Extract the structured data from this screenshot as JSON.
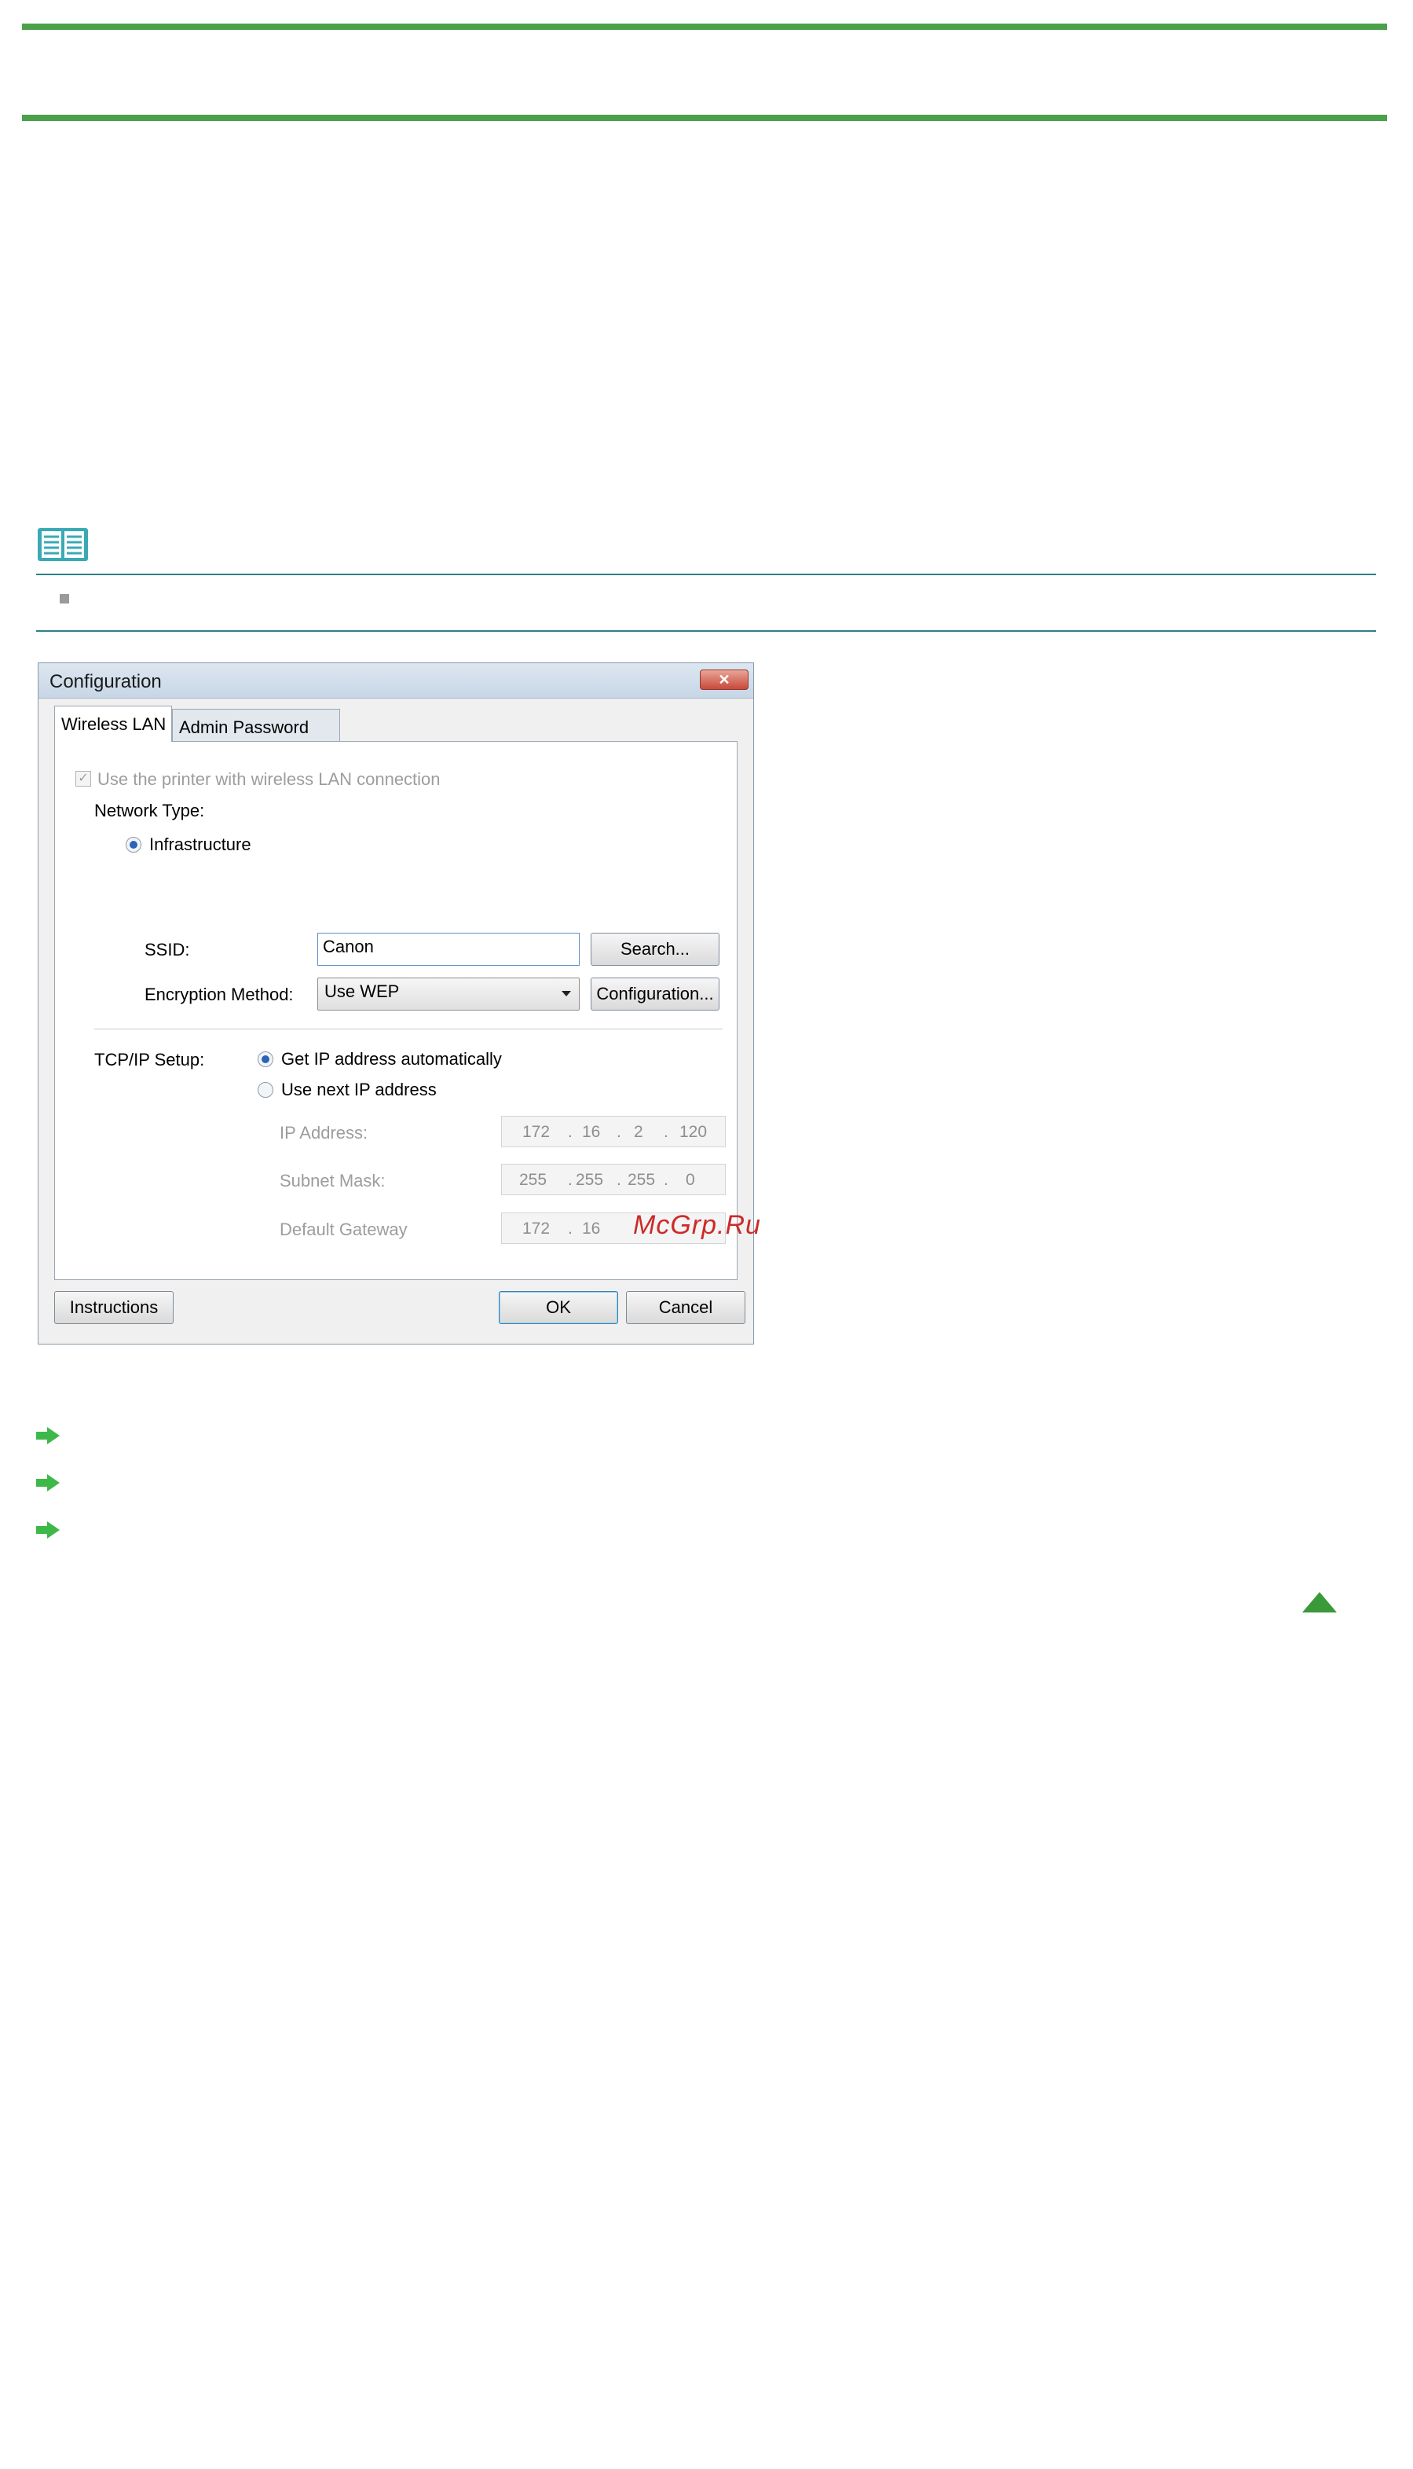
{
  "colors": {
    "rule": "#4aa14a",
    "note_line": "#2f7f86",
    "link_arrow": "#3fb84a",
    "watermark": "#cc2a2a"
  },
  "icons": {
    "note": "note-book-icon",
    "link": "right-arrow-icon",
    "top": "up-triangle-icon"
  },
  "dialog": {
    "title": "Configuration",
    "tabs": [
      "Wireless LAN",
      "Admin Password"
    ],
    "use_wireless_label": "Use the printer with wireless LAN connection",
    "network_type_label": "Network Type:",
    "infrastructure_label": "Infrastructure",
    "ssid_label": "SSID:",
    "ssid_value": "Canon",
    "search_button": "Search...",
    "encryption_label": "Encryption Method:",
    "encryption_value": "Use WEP",
    "configuration_button": "Configuration...",
    "tcpip_label": "TCP/IP Setup:",
    "auto_ip_label": "Get IP address automatically",
    "next_ip_label": "Use next IP address",
    "ip_address_label": "IP Address:",
    "subnet_label": "Subnet Mask:",
    "gateway_label": "Default Gateway",
    "ip_address": [
      "172",
      "16",
      "2",
      "120"
    ],
    "subnet_mask": [
      "255",
      "255",
      "255",
      "0"
    ],
    "default_gateway": [
      "172",
      "16"
    ],
    "instructions_button": "Instructions",
    "ok_button": "OK",
    "cancel_button": "Cancel"
  },
  "watermark": "McGrp.Ru"
}
